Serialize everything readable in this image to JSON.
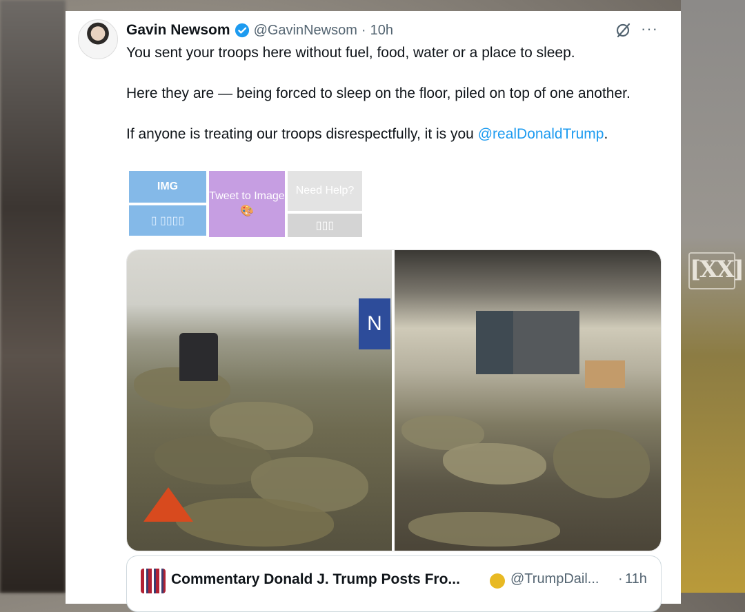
{
  "colors": {
    "link": "#1d9bf0",
    "verified": "#1d9bf0",
    "text": "#0f1419",
    "secondary": "#536471",
    "gold_badge": "#e8b923"
  },
  "background_logo": "[XX]",
  "tweet": {
    "author_name": "Gavin Newsom",
    "handle": "@GavinNewsom",
    "separator": "·",
    "time": "10h",
    "text_line1": "You sent your troops here without fuel, food, water or a place to sleep.",
    "text_line2": "Here they are — being forced to sleep on the floor, piled on top of one another.",
    "text_line3_prefix": "If anyone is treating our troops disrespectfully, it is you ",
    "mention": "@realDonaldTrump",
    "text_line3_suffix": ".",
    "more_label": "···"
  },
  "extension_widget": {
    "img_label": "IMG",
    "img_sub_label": "▯ ▯▯▯▯",
    "tweet_to_image": "Tweet to Image",
    "need_help": "Need Help?",
    "help_sub": "▯▯▯"
  },
  "media": {
    "left_sign": "N"
  },
  "quote_tweet": {
    "title": "Commentary Donald J. Trump Posts Fro...",
    "handle": "@TrumpDail...",
    "separator": "·",
    "time": "11h"
  }
}
